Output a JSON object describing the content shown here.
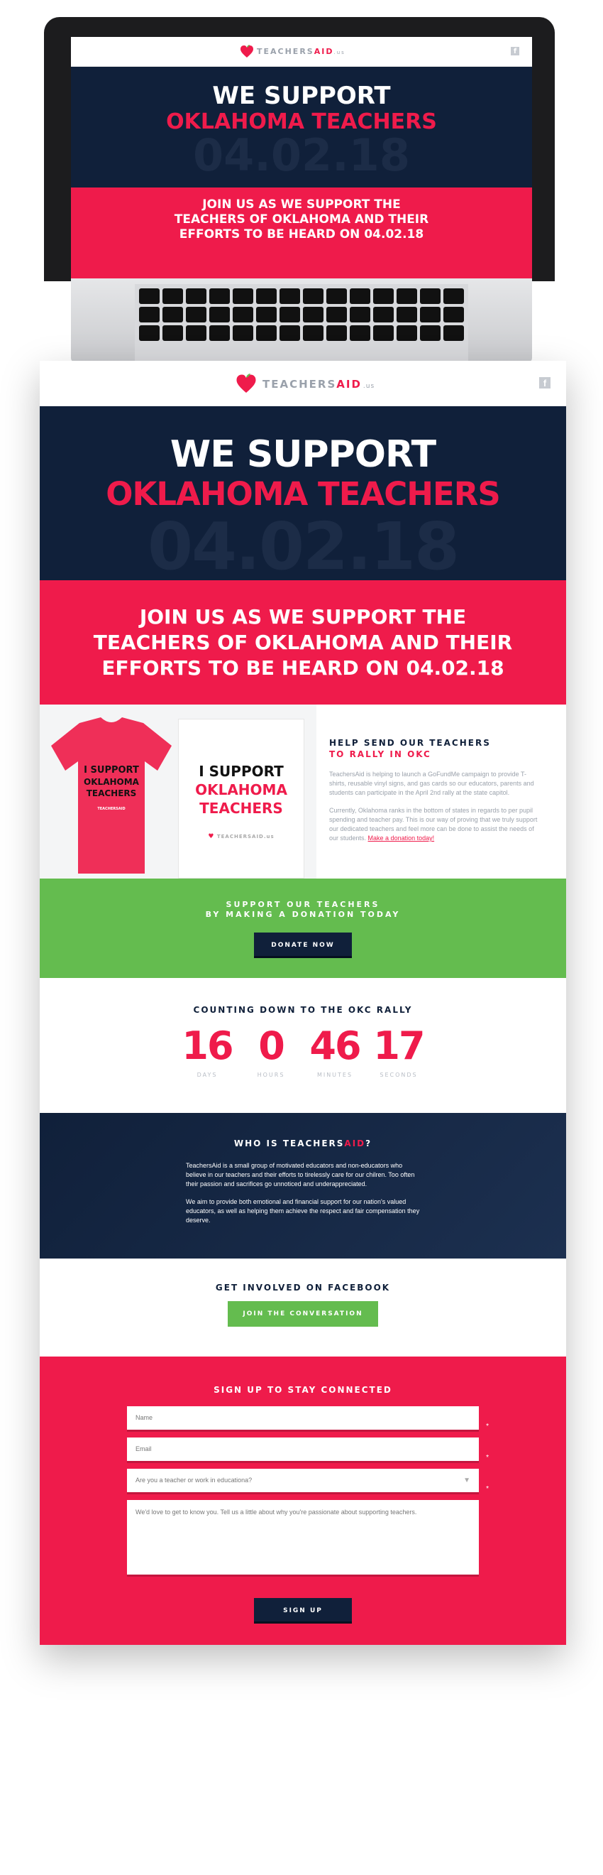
{
  "mockup": {
    "logo": {
      "main": "TEACHERS",
      "accent": "AID",
      "suffix": ".us"
    },
    "hero_line1": "WE SUPPORT",
    "hero_line2": "OKLAHOMA TEACHERS",
    "hero_date": "04.02.18",
    "band_lines": [
      "JOIN US AS WE SUPPORT THE",
      "TEACHERS OF OKLAHOMA AND THEIR",
      "EFFORTS TO BE HEARD ON 04.02.18"
    ]
  },
  "header": {
    "logo_main": "TEACHERS",
    "logo_accent": "AID",
    "logo_suffix": ".us",
    "social_icon": "facebook-icon"
  },
  "hero": {
    "line1": "WE SUPPORT",
    "line2": "OKLAHOMA TEACHERS",
    "date": "04.02.18"
  },
  "join": {
    "lines": [
      "JOIN US AS WE SUPPORT THE",
      "TEACHERS OF OKLAHOMA AND THEIR",
      "EFFORTS TO BE HEARD ON 04.02.18"
    ]
  },
  "info": {
    "shirt_lines": [
      "I SUPPORT",
      "OKLAHOMA",
      "TEACHERS"
    ],
    "shirt_logo": "TEACHERSAID",
    "card_line1": "I SUPPORT",
    "card_line2": "OKLAHOMA",
    "card_line3": "TEACHERS",
    "card_logo": "TEACHERSAID.us",
    "title": "HELP SEND OUR TEACHERS",
    "subtitle": "TO RALLY IN OKC",
    "paragraph1": "TeachersAid is helping to launch a GoFundMe campaign to provide T-shirts, reusable vinyl signs, and gas cards so our educators, parents and students can participate in the April 2nd rally at the state capitol.",
    "paragraph2": "Currently, Oklahoma ranks in the bottom of states in regards to per pupil spending and teacher pay.  This is our way of proving that we truly support our dedicated teachers and feel more can be done to assist the needs of our students.",
    "link": "Make a donation today!"
  },
  "donate": {
    "line1": "SUPPORT OUR TEACHERS",
    "line2": "BY MAKING A DONATION TODAY",
    "button": "DONATE NOW"
  },
  "countdown": {
    "title": "COUNTING DOWN TO THE OKC RALLY",
    "units": [
      {
        "value": "16",
        "label": "DAYS"
      },
      {
        "value": "0",
        "label": "HOURS"
      },
      {
        "value": "46",
        "label": "MINUTES"
      },
      {
        "value": "17",
        "label": "SECONDS"
      }
    ]
  },
  "who": {
    "title_main": "WHO IS TEACHERS",
    "title_accent": "AID",
    "title_end": "?",
    "paragraph1": "TeachersAid is a small group of motivated educators and non-educators who believe in our teachers and  their efforts to tirelessly care for our chilren. Too often their passion and sacrifices go unnoticed and underappreciated.",
    "paragraph2": "We aim to provide both emotional and financial support for our nation's valued educators, as well as helping them achieve the respect and fair compensation they deserve."
  },
  "facebook": {
    "title": "GET INVOLVED ON FACEBOOK",
    "button": "JOIN THE CONVERSATION"
  },
  "signup": {
    "title": "SIGN UP TO STAY CONNECTED",
    "name_placeholder": "Name",
    "email_placeholder": "Email",
    "select_placeholder": "Are you a teacher or work in educationa?",
    "message_placeholder": "We'd love to get to know you. Tell us a little about why you're passionate about supporting teachers.",
    "required_mark": "*",
    "button": "SIGN UP"
  },
  "colors": {
    "navy": "#10203a",
    "red": "#ef1b4b",
    "green": "#64bc4f"
  }
}
